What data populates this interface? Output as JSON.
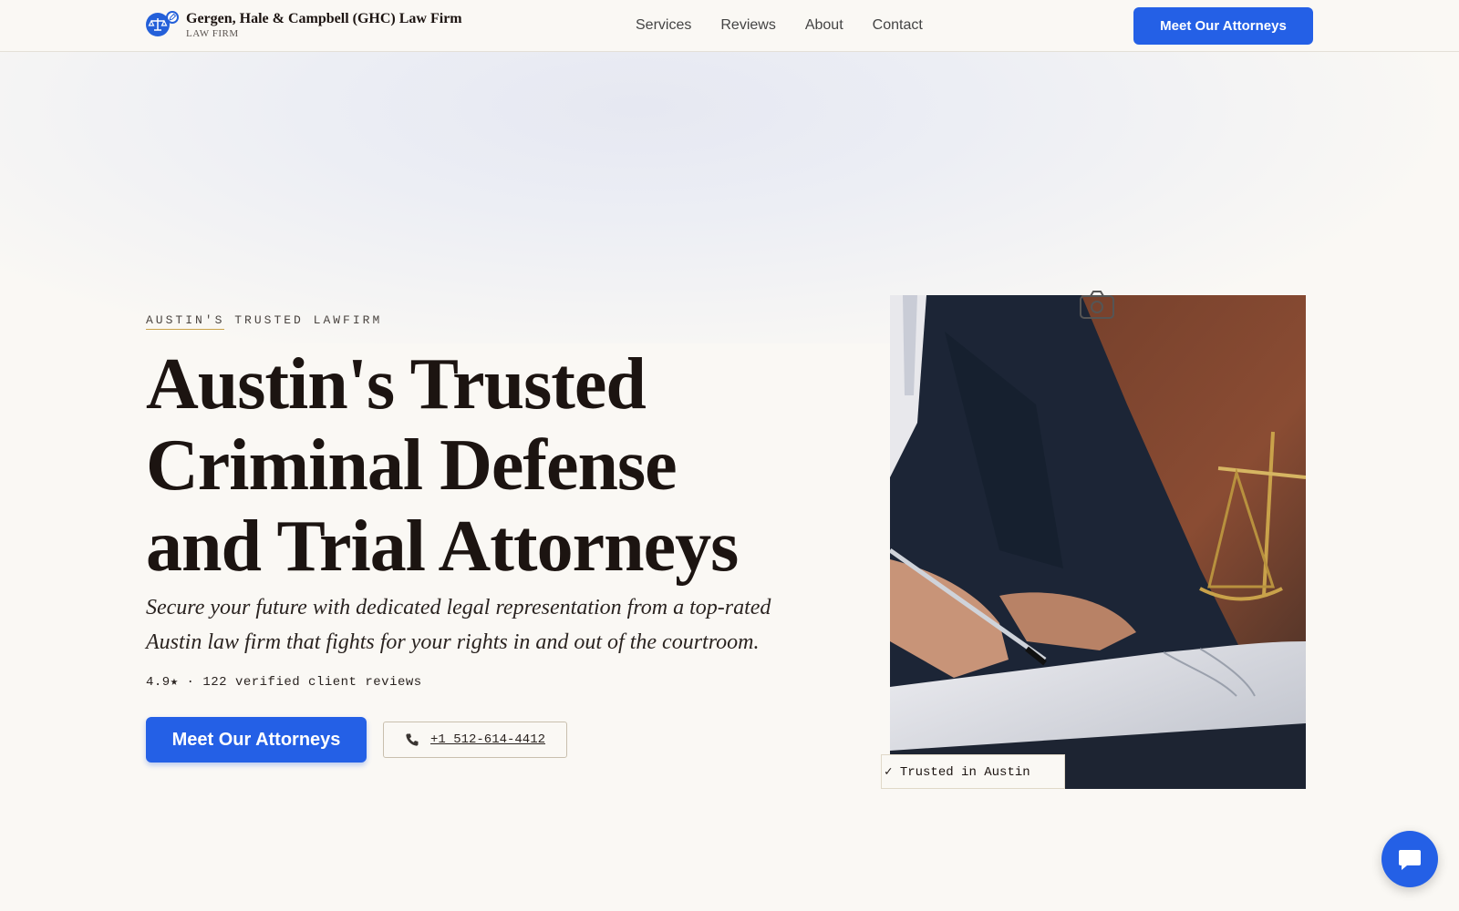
{
  "header": {
    "brand_name": "Gergen, Hale & Campbell (GHC) Law Firm",
    "brand_sub": "LAW FIRM",
    "nav": [
      "Services",
      "Reviews",
      "About",
      "Contact"
    ],
    "cta_label": "Meet Our Attorneys"
  },
  "hero": {
    "eyebrow_part1": "AUSTIN'S",
    "eyebrow_part2": "TRUSTED LAWFIRM",
    "headline": "Austin's Trusted Criminal Defense and Trial Attorneys",
    "subtitle": "Secure your future with dedicated legal representation from a top-rated Austin law firm that fights for your rights in and out of the courtroom.",
    "rating": "4.9★ · 122 verified client reviews",
    "cta_primary": "Meet Our Attorneys",
    "phone": "+1 512-614-4412",
    "badge": "✓ Trusted in Austin"
  },
  "colors": {
    "accent": "#2460e6",
    "text": "#1c1411",
    "background": "#faf8f4",
    "gold": "#c9a24a"
  },
  "icons": {
    "logo": "scales-icon",
    "phone": "phone-icon",
    "camera": "camera-icon",
    "chat": "chat-icon"
  }
}
